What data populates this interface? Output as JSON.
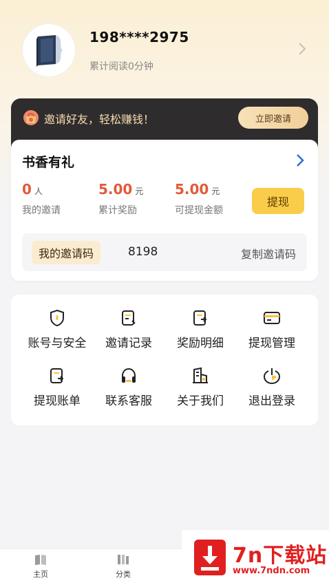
{
  "profile": {
    "username": "198****2975",
    "read_time": "累计阅读0分钟"
  },
  "banner": {
    "text": "邀请好友，轻松赚钱！",
    "button_label": "立即邀请"
  },
  "gift_card": {
    "title": "书香有礼",
    "stats": [
      {
        "value": "0",
        "unit": "人",
        "label": "我的邀请"
      },
      {
        "value": "5.00",
        "unit": "元",
        "label": "累计奖励"
      },
      {
        "value": "5.00",
        "unit": "元",
        "label": "可提现金额"
      }
    ],
    "withdraw_label": "提现",
    "code_label": "我的邀请码",
    "code_value": "8198",
    "copy_label": "复制邀请码"
  },
  "menu": {
    "items": [
      {
        "label": "账号与安全",
        "icon": "shield-icon"
      },
      {
        "label": "邀请记录",
        "icon": "document-icon"
      },
      {
        "label": "奖励明细",
        "icon": "reward-detail-icon"
      },
      {
        "label": "提现管理",
        "icon": "card-icon"
      },
      {
        "label": "提现账单",
        "icon": "bill-icon"
      },
      {
        "label": "联系客服",
        "icon": "headset-icon"
      },
      {
        "label": "关于我们",
        "icon": "building-icon"
      },
      {
        "label": "退出登录",
        "icon": "power-icon"
      }
    ]
  },
  "tabbar": {
    "tabs": [
      {
        "label": "主页",
        "icon": "book-icon"
      },
      {
        "label": "分类",
        "icon": "category-icon"
      }
    ]
  },
  "watermark": {
    "title": "7n下载站",
    "url": "www.7ndn.com"
  },
  "colors": {
    "accent_red": "#e25a3a",
    "button_yellow": "#f9cd4a",
    "banner_dark": "#2f2c2e",
    "banner_text": "#f6dcae"
  }
}
